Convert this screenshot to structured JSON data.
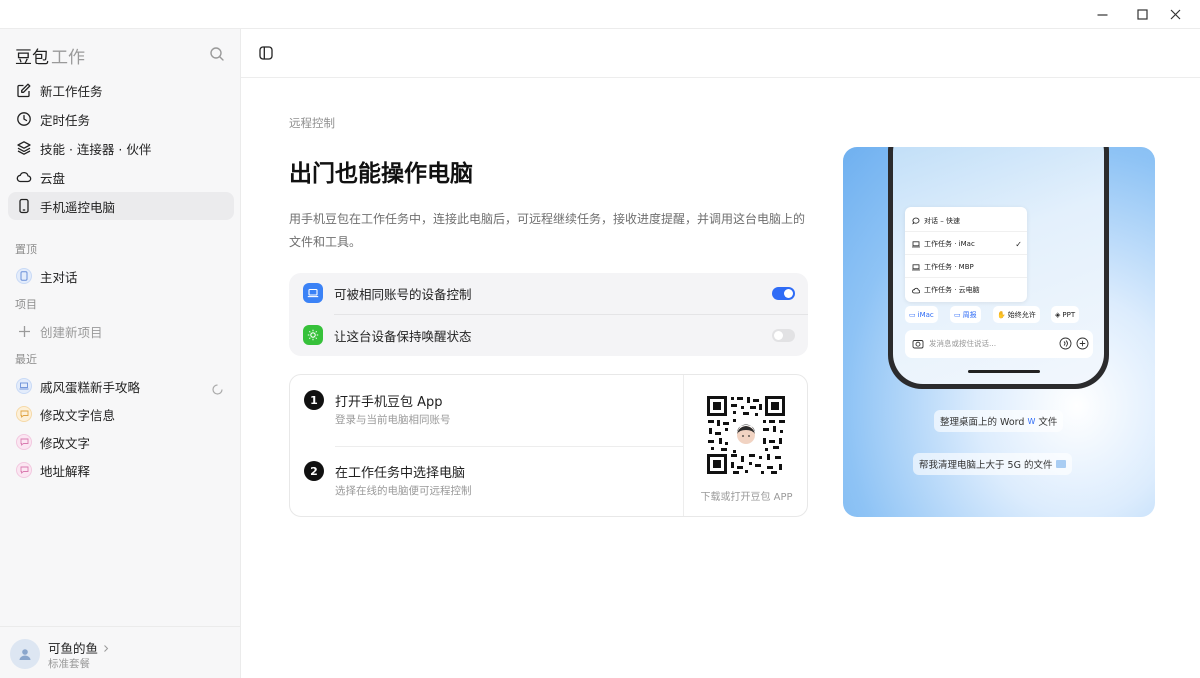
{
  "window": {
    "minimize_icon": "minimize-icon",
    "maximize_icon": "maximize-icon",
    "close_icon": "close-icon"
  },
  "sidebar": {
    "brand": "豆包",
    "brand_sub": "工作",
    "nav": [
      {
        "label": "新工作任务",
        "icon": "edit-icon"
      },
      {
        "label": "定时任务",
        "icon": "clock-icon"
      },
      {
        "label": "技能 · 连接器 · 伙伴",
        "icon": "layers-icon"
      },
      {
        "label": "云盘",
        "icon": "cloud-icon"
      },
      {
        "label": "手机遥控电脑",
        "icon": "phone-icon"
      }
    ],
    "pinned_heading": "置顶",
    "pinned": [
      {
        "label": "主对话"
      }
    ],
    "projects_heading": "项目",
    "new_project": "创建新项目",
    "recent_heading": "最近",
    "recent": [
      {
        "label": "戚风蛋糕新手攻略"
      },
      {
        "label": "修改文字信息"
      },
      {
        "label": "修改文字"
      },
      {
        "label": "地址解释"
      }
    ],
    "user": {
      "name": "可鱼的鱼",
      "plan": "标准套餐"
    }
  },
  "main": {
    "breadcrumb": "远程控制",
    "title": "出门也能操作电脑",
    "description": "用手机豆包在工作任务中，连接此电脑后，可远程继续任务，接收进度提醒，并调用这台电脑上的文件和工具。",
    "settings": [
      {
        "label": "可被相同账号的设备控制",
        "enabled": true
      },
      {
        "label": "让这台设备保持唤醒状态",
        "enabled": false
      }
    ],
    "steps": [
      {
        "num": "1",
        "title": "打开手机豆包 App",
        "sub": "登录与当前电脑相同账号"
      },
      {
        "num": "2",
        "title": "在工作任务中选择电脑",
        "sub": "选择在线的电脑便可远程控制"
      }
    ],
    "qr_caption": "下载或打开豆包 APP"
  },
  "promo": {
    "menu": [
      {
        "label": "对话 – 快速",
        "check": false
      },
      {
        "label": "工作任务 · iMac",
        "check": true
      },
      {
        "label": "工作任务 · MBP",
        "check": false
      },
      {
        "label": "工作任务 · 云电脑",
        "check": false
      }
    ],
    "check_mark": "✓",
    "chips": [
      "iMac",
      "周报",
      "始终允许",
      "PPT"
    ],
    "input_placeholder": "发消息或按住说话...",
    "bubble1": "整理桌面上的 Word",
    "bubble1_suffix": "文件",
    "bubble2": "帮我清理电脑上大于 5G 的文件"
  },
  "colors": {
    "accent": "#2f6cf6",
    "toggle_off": "#e2e2e4",
    "green": "#36c13a"
  }
}
